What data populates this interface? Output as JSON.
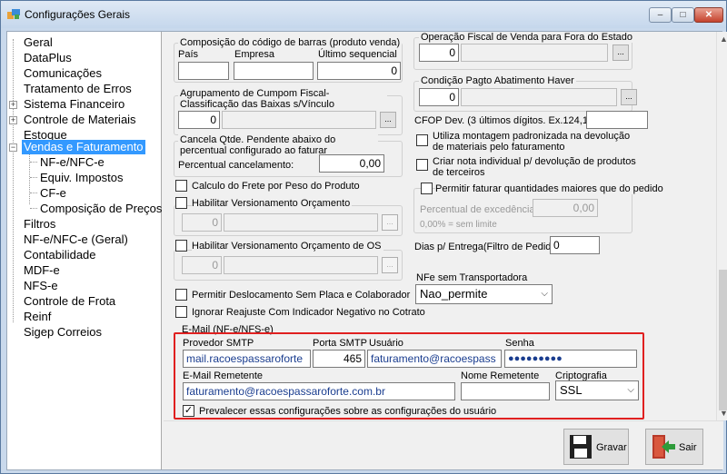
{
  "window": {
    "title": "Configurações Gerais",
    "controls": {
      "minimize": "–",
      "maximize": "□",
      "close": "✕"
    }
  },
  "tree": {
    "items": [
      {
        "label": "Geral"
      },
      {
        "label": "DataPlus"
      },
      {
        "label": "Comunicações"
      },
      {
        "label": "Tratamento de Erros"
      },
      {
        "label": "Sistema Financeiro"
      },
      {
        "label": "Controle de Materiais"
      },
      {
        "label": "Estoque"
      },
      {
        "label": "Vendas e Faturamento"
      },
      {
        "label": "NF-e/NFC-e"
      },
      {
        "label": "Equiv. Impostos"
      },
      {
        "label": "CF-e"
      },
      {
        "label": "Composição de Preços"
      },
      {
        "label": "Filtros"
      },
      {
        "label": "NF-e/NFC-e (Geral)"
      },
      {
        "label": "Contabilidade"
      },
      {
        "label": "MDF-e"
      },
      {
        "label": "NFS-e"
      },
      {
        "label": "Controle de Frota"
      },
      {
        "label": "Reinf"
      },
      {
        "label": "Sigep Correios"
      }
    ]
  },
  "left": {
    "barcode": {
      "title": "Composição do código de barras (produto venda)",
      "pais_label": "País",
      "empresa_label": "Empresa",
      "ultimo_label": "Último sequencial",
      "pais_value": "",
      "empresa_value": "",
      "ultimo_value": "0"
    },
    "agrupamento": {
      "title": "Agrupamento de Cumpom Fiscal-Classificação das Baixas s/Vínculo",
      "value": "0",
      "desc": "",
      "btn": "..."
    },
    "cancela": {
      "title": "Cancela Qtde. Pendente abaixo do percentual configurado ao faturar",
      "label": "Percentual cancelamento:",
      "value": "0,00"
    },
    "calculo_frete": "Calculo do Frete por Peso do Produto",
    "hab_orcamento": {
      "label": "Habilitar Versionamento Orçamento",
      "value": "0",
      "btn": "..."
    },
    "hab_orcamento_os": {
      "label": "Habilitar Versionamento Orçamento de OS",
      "value": "0",
      "btn": "..."
    },
    "permitir_deslocamento": "Permitir Deslocamento Sem Placa e Colaborador",
    "ignorar_reajuste": "Ignorar Reajuste Com Indicador Negativo no Cotrato",
    "email_title": "E-Mail (NF-e/NFS-e)"
  },
  "right": {
    "operacao": {
      "title": "Operação Fiscal de Venda para Fora do Estado",
      "value": "0",
      "btn": "..."
    },
    "condicao": {
      "title": "Condição Pagto Abatimento Haver",
      "value": "0",
      "btn": "..."
    },
    "cfop_label": "CFOP Dev. (3 últimos dígitos. Ex.124,125):",
    "cfop_value": "",
    "montagem": "Utiliza montagem padronizada na devolução de materiais pelo faturamento",
    "nota_individual": "Criar nota individual p/ devolução de produtos de terceiros",
    "faturar_group": {
      "title": "Permitir faturar quantidades maiores que do pedido",
      "perc_label": "Percentual de excedência:",
      "perc_value": "0,00",
      "hint": "0,00% = sem limite"
    },
    "dias_label": "Dias p/ Entrega(Filtro de Pedido):",
    "dias_value": "0",
    "nfe_sem_transp_label": "NFe sem Transportadora",
    "nfe_sem_transp_value": "Nao_permite"
  },
  "email": {
    "provedor_label": "Provedor SMTP",
    "provedor_value": "mail.racoespassaroforte",
    "porta_label": "Porta SMTP",
    "porta_value": "465",
    "usuario_label": "Usuário",
    "usuario_value": "faturamento@racoespass",
    "senha_label": "Senha",
    "senha_value": "●●●●●●●●●",
    "remetente_label": "E-Mail Remetente",
    "remetente_value": "faturamento@racoespassaroforte.com.br",
    "nome_rem_label": "Nome Remetente",
    "nome_rem_value": "",
    "cripto_label": "Criptografia",
    "cripto_value": "SSL",
    "prevalecer": "Prevalecer essas configurações sobre as configurações do usuário",
    "prevalecer_checked": "✓"
  },
  "buttons": {
    "gravar": "Gravar",
    "sair": "Sair"
  },
  "colors": {
    "highlight": "#e02020",
    "selection": "#3399ff"
  }
}
